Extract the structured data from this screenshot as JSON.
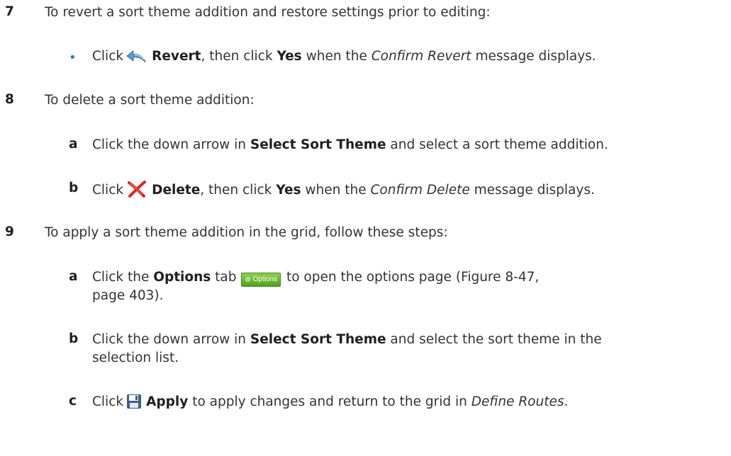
{
  "steps": {
    "s7": {
      "num": "7",
      "intro": "To revert a sort theme addition and restore settings prior to editing:",
      "bullet": {
        "click": "Click",
        "button": "Revert",
        "mid": ", then click",
        "yes": "Yes",
        "when": "when the",
        "dialog": "Confirm Revert",
        "tail": "message displays."
      }
    },
    "s8": {
      "num": "8",
      "intro": "To delete a sort theme addition:",
      "a": {
        "letter": "a",
        "pre": "Click the down arrow in",
        "field": "Select Sort Theme",
        "post": "and select a sort theme addition."
      },
      "b": {
        "letter": "b",
        "click": "Click",
        "button": "Delete",
        "mid": ", then click",
        "yes": "Yes",
        "when": "when the",
        "dialog": "Confirm Delete",
        "tail": "message displays."
      }
    },
    "s9": {
      "num": "9",
      "intro": "To apply a sort theme addition in the grid, follow these steps:",
      "a": {
        "letter": "a",
        "pre": "Click the",
        "tab_name": "Options",
        "tab_word": "tab",
        "tab_label": "Options",
        "post1": "to open the options page (Figure 8-47,",
        "post2": "page 403)."
      },
      "b": {
        "letter": "b",
        "pre": "Click the down arrow in",
        "field": "Select Sort Theme",
        "post1": "and select the sort theme in the",
        "post2": "selection list."
      },
      "c": {
        "letter": "c",
        "click": "Click",
        "button": "Apply",
        "post": "to apply changes and return to the grid in",
        "place": "Define Routes",
        "end": "."
      }
    }
  },
  "icons": {
    "revert": "revert-arrow-icon",
    "delete": "red-x-delete-icon",
    "apply": "floppy-disk-save-icon",
    "options": "gear-icon"
  },
  "colors": {
    "bullet": "#1f7fc3",
    "text": "#333333",
    "options_tab": "#5cae2a",
    "delete_icon": "#e0201b",
    "revert_icon": "#5a9bd5",
    "apply_icon": "#3b5f86"
  }
}
